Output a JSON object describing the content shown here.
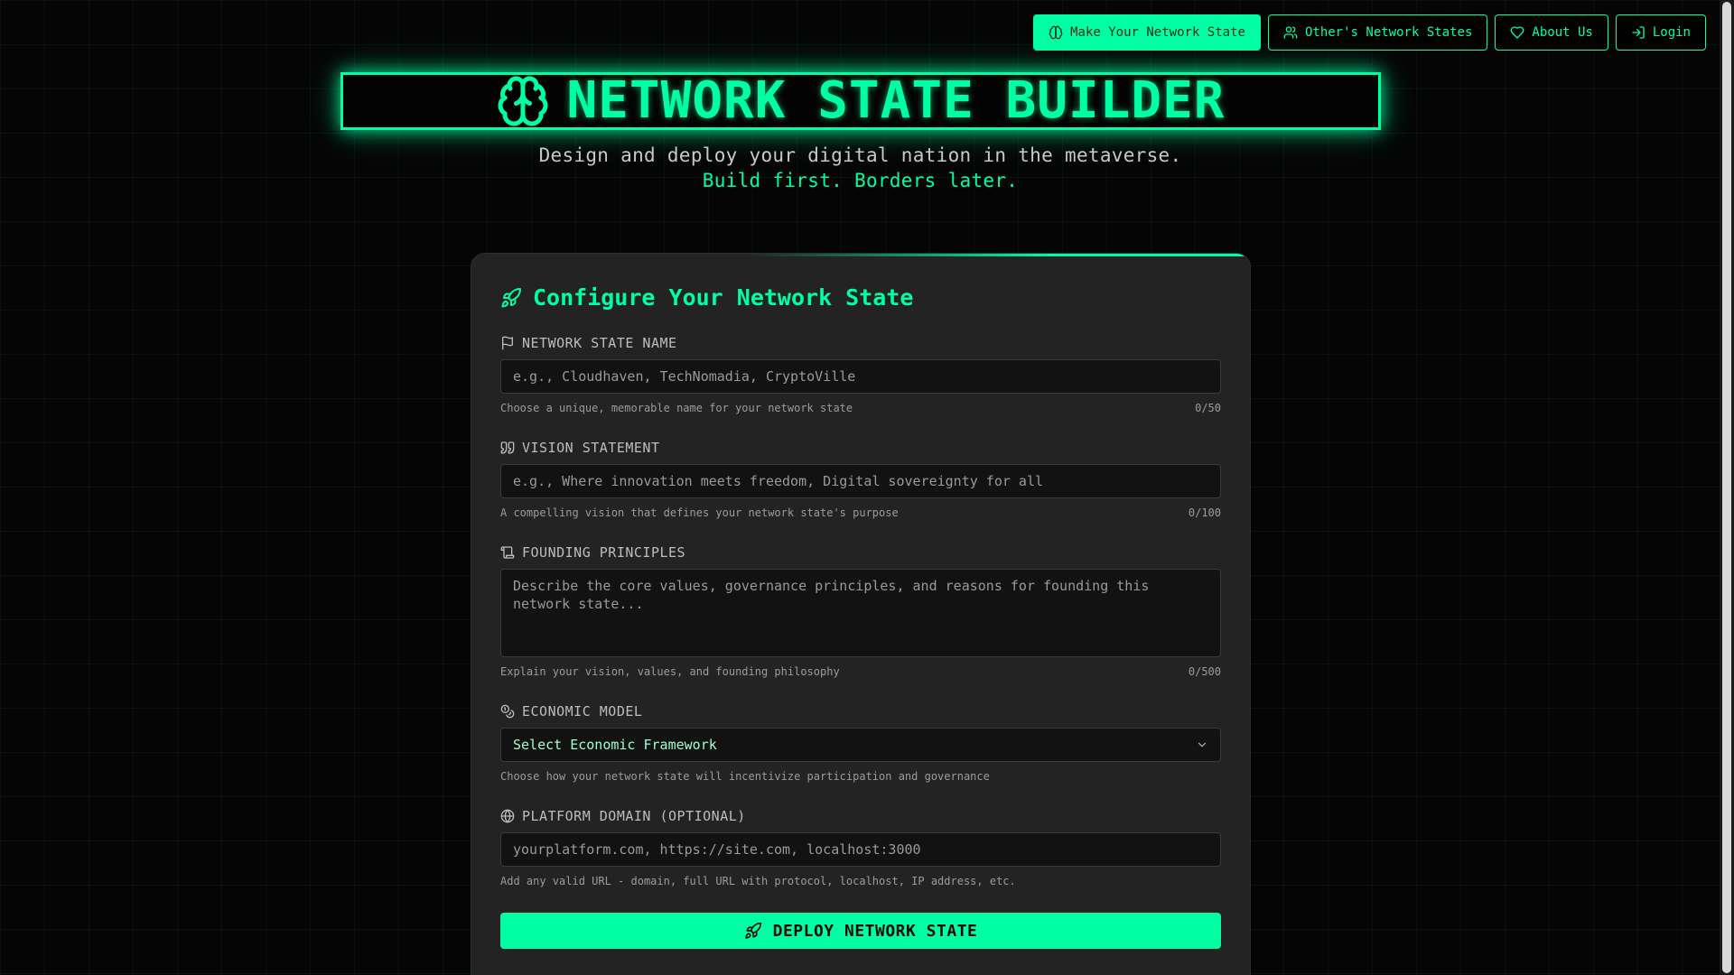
{
  "nav": {
    "make_label": "Make Your Network State",
    "others_label": "Other's Network States",
    "about_label": "About Us",
    "login_label": "Login"
  },
  "hero": {
    "title": "NETWORK STATE BUILDER",
    "subtitle": "Design and deploy your digital nation in the metaverse.",
    "tagline": "Build first. Borders later."
  },
  "form": {
    "title": "Configure Your Network State",
    "name": {
      "label": "NETWORK STATE NAME",
      "placeholder": "e.g., Cloudhaven, TechNomadia, CryptoVille",
      "value": "",
      "hint": "Choose a unique, memorable name for your network state",
      "count": "0/50"
    },
    "vision": {
      "label": "VISION STATEMENT",
      "placeholder": "e.g., Where innovation meets freedom, Digital sovereignty for all",
      "value": "",
      "hint": "A compelling vision that defines your network state's purpose",
      "count": "0/100"
    },
    "principles": {
      "label": "FOUNDING PRINCIPLES",
      "placeholder": "Describe the core values, governance principles, and reasons for founding this network state...",
      "value": "",
      "hint": "Explain your vision, values, and founding philosophy",
      "count": "0/500"
    },
    "economic": {
      "label": "ECONOMIC MODEL",
      "selected": "Select Economic Framework",
      "hint": "Choose how your network state will incentivize participation and governance"
    },
    "domain": {
      "label": "PLATFORM DOMAIN (OPTIONAL)",
      "placeholder": "yourplatform.com, https://site.com, localhost:3000",
      "value": "",
      "hint": "Add any valid URL - domain, full URL with protocol, localhost, IP address, etc."
    },
    "deploy_label": "DEPLOY NETWORK STATE"
  },
  "colors": {
    "accent": "#00ffa3",
    "background": "#050505",
    "card": "#232323",
    "input": "#121212"
  },
  "icons": {
    "make": "brain-icon",
    "others": "users-icon",
    "about": "heart-icon",
    "login": "login-icon",
    "hero": "brain-icon",
    "form_title": "rocket-icon",
    "name": "flag-icon",
    "vision": "quote-icon",
    "principles": "scroll-icon",
    "economic": "coins-icon",
    "domain": "globe-icon",
    "select": "chevron-down-icon",
    "deploy": "rocket-icon"
  }
}
